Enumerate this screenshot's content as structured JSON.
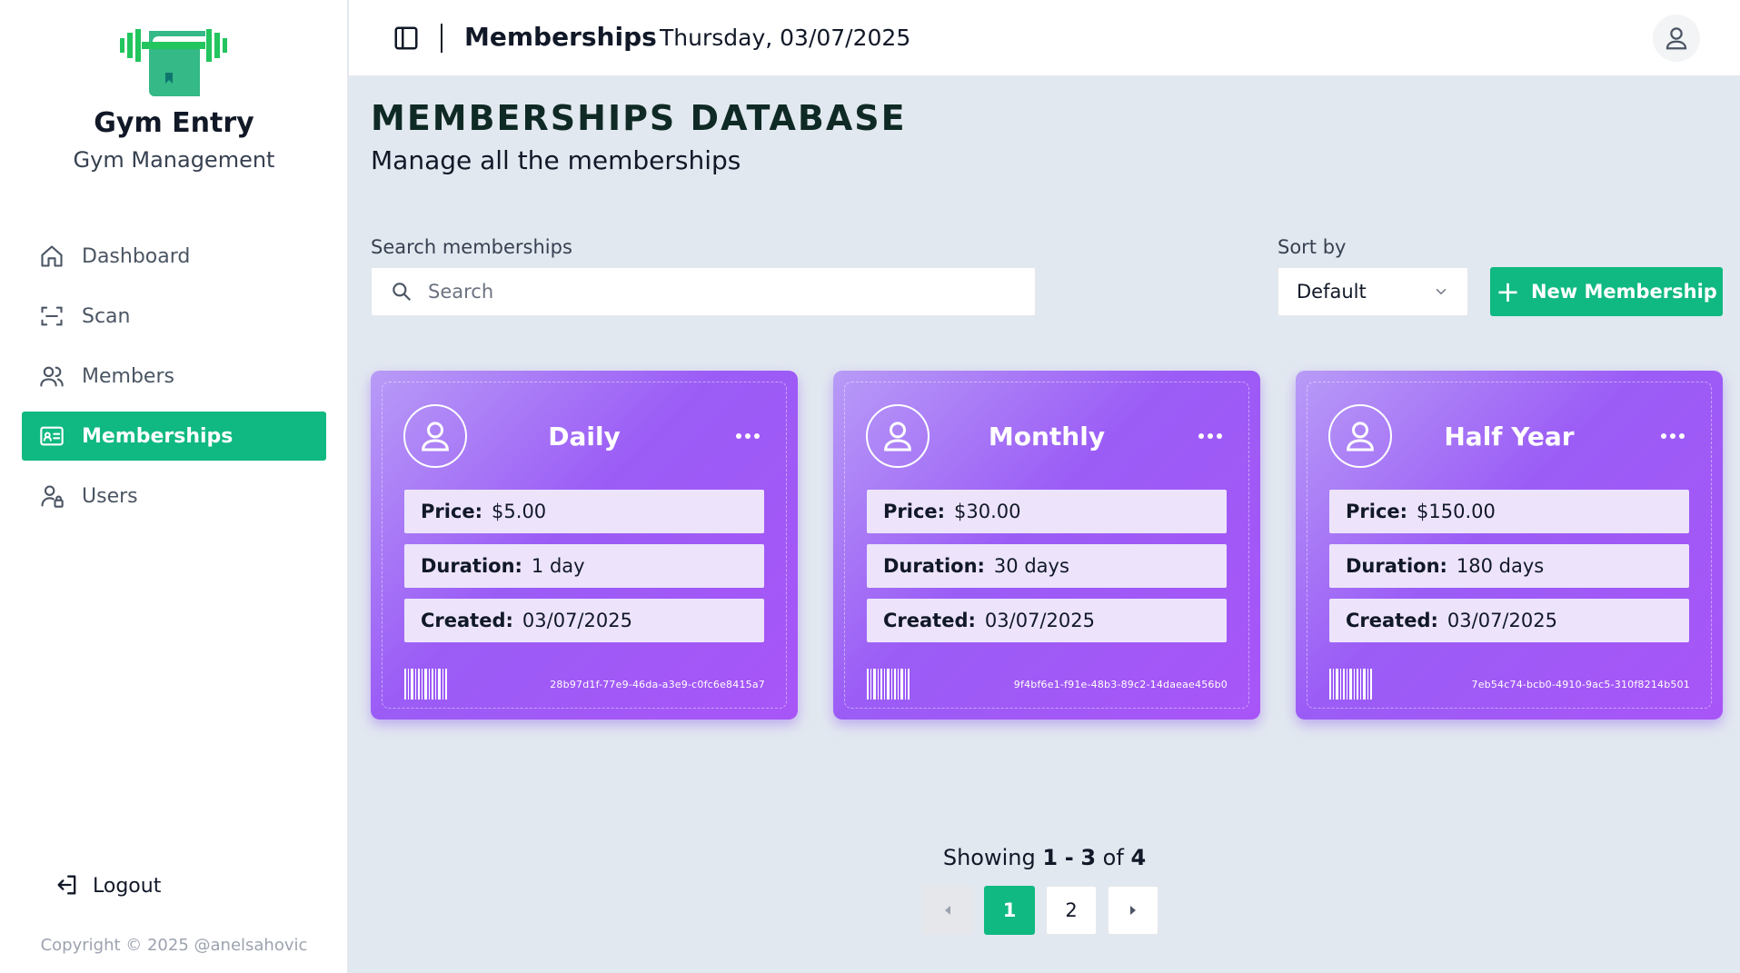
{
  "sidebar": {
    "brand_title": "Gym Entry",
    "brand_subtitle": "Gym Management",
    "logo_icon": "dumbbell-book-icon",
    "items": [
      {
        "label": "Dashboard",
        "icon": "home-icon",
        "active": false
      },
      {
        "label": "Scan",
        "icon": "scan-icon",
        "active": false
      },
      {
        "label": "Members",
        "icon": "users-icon",
        "active": false
      },
      {
        "label": "Memberships",
        "icon": "id-card-icon",
        "active": true
      },
      {
        "label": "Users",
        "icon": "user-lock-icon",
        "active": false
      }
    ],
    "logout_label": "Logout",
    "copyright": "Copyright © 2025 @anelsahovic"
  },
  "header": {
    "title": "Memberships",
    "date": "Thursday, 03/07/2025"
  },
  "main": {
    "title": "MEMBERSHIPS DATABASE",
    "subtitle": "Manage all the memberships",
    "search_label": "Search memberships",
    "search_placeholder": "Search",
    "sort_label": "Sort by",
    "sort_value": "Default",
    "new_button_label": "New Membership"
  },
  "cards": [
    {
      "name": "Daily",
      "price_label": "Price:",
      "price": "$5.00",
      "duration_label": "Duration:",
      "duration": "1 day",
      "created_label": "Created:",
      "created": "03/07/2025",
      "id": "28b97d1f-77e9-46da-a3e9-c0fc6e8415a7"
    },
    {
      "name": "Monthly",
      "price_label": "Price:",
      "price": "$30.00",
      "duration_label": "Duration:",
      "duration": "30 days",
      "created_label": "Created:",
      "created": "03/07/2025",
      "id": "9f4bf6e1-f91e-48b3-89c2-14daeae456b0"
    },
    {
      "name": "Half Year",
      "price_label": "Price:",
      "price": "$150.00",
      "duration_label": "Duration:",
      "duration": "180 days",
      "created_label": "Created:",
      "created": "03/07/2025",
      "id": "7eb54c74-bcb0-4910-9ac5-310f8214b501"
    }
  ],
  "pagination": {
    "showing_prefix": "Showing",
    "from": "1",
    "dash": "-",
    "to": "3",
    "of_word": "of",
    "total": "4",
    "pages": [
      "1",
      "2"
    ],
    "current_page": "1"
  },
  "colors": {
    "accent": "#10b981",
    "card_purple": "#9b5cf6",
    "card_field": "#ede4fc",
    "background": "#e2e8f0"
  }
}
